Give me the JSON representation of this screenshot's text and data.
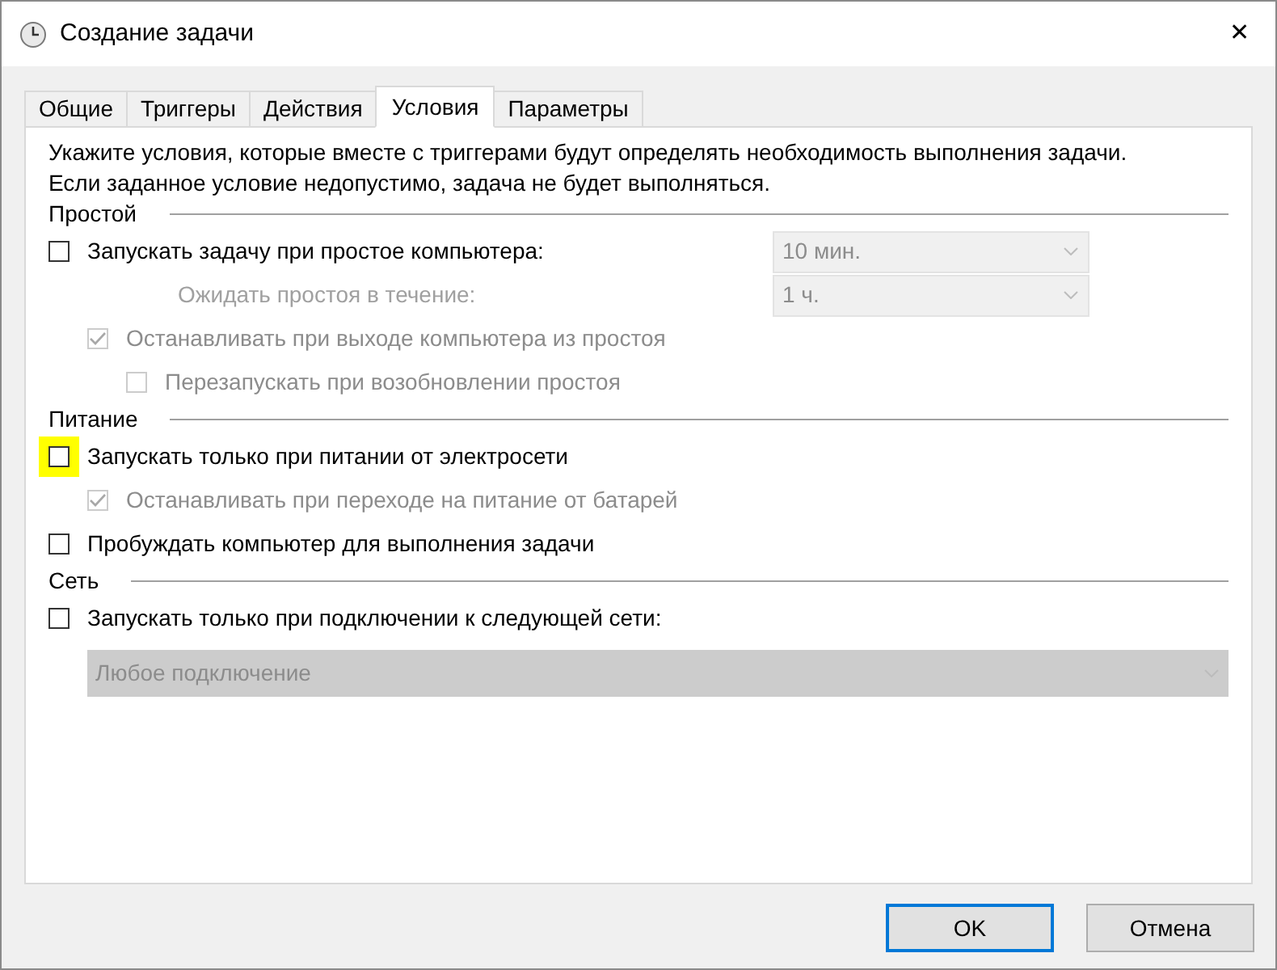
{
  "window": {
    "title": "Создание задачи",
    "close": "✕"
  },
  "tabs": [
    {
      "label": "Общие",
      "selected": false
    },
    {
      "label": "Триггеры",
      "selected": false
    },
    {
      "label": "Действия",
      "selected": false
    },
    {
      "label": "Условия",
      "selected": true
    },
    {
      "label": "Параметры",
      "selected": false
    }
  ],
  "intro": [
    "Укажите условия, которые вместе с триггерами будут определять необходимость выполнения задачи.",
    "Если заданное условие недопустимо, задача не будет выполняться."
  ],
  "sections": [
    {
      "title": "Простой",
      "items": [
        {
          "kind": "checkbox",
          "label": "Запускать задачу при простое компьютера:",
          "checked": false,
          "disabled": false,
          "dropdown": {
            "value": "10 мин.",
            "disabled": true
          },
          "children": [
            {
              "kind": "dropdown_row",
              "label": "Ожидать простоя в течение:",
              "disabled": true,
              "dropdown": {
                "value": "1 ч.",
                "disabled": true
              }
            },
            {
              "kind": "checkbox",
              "label": "Останавливать при выходе компьютера из простоя",
              "checked": true,
              "disabled": true,
              "children": [
                {
                  "kind": "checkbox",
                  "label": "Перезапускать при возобновлении простоя",
                  "checked": false,
                  "disabled": true
                }
              ]
            }
          ]
        }
      ]
    },
    {
      "title": "Питание",
      "items": [
        {
          "kind": "checkbox",
          "label": "Запускать только при питании от электросети",
          "checked": false,
          "disabled": false,
          "highlighted": true,
          "children": [
            {
              "kind": "checkbox",
              "label": "Останавливать при переходе на питание от батарей",
              "checked": true,
              "disabled": true
            }
          ]
        },
        {
          "kind": "checkbox",
          "label": "Пробуждать компьютер для выполнения задачи",
          "checked": false,
          "disabled": false
        }
      ]
    },
    {
      "title": "Сеть",
      "items": [
        {
          "kind": "checkbox",
          "label": "Запускать только при подключении к следующей сети:",
          "checked": false,
          "disabled": false,
          "children": [
            {
              "kind": "wide_dropdown",
              "value": "Любое подключение",
              "disabled": true
            }
          ]
        }
      ]
    }
  ],
  "buttons": [
    {
      "label": "OK",
      "default": true
    },
    {
      "label": "Отмена",
      "default": false
    }
  ]
}
